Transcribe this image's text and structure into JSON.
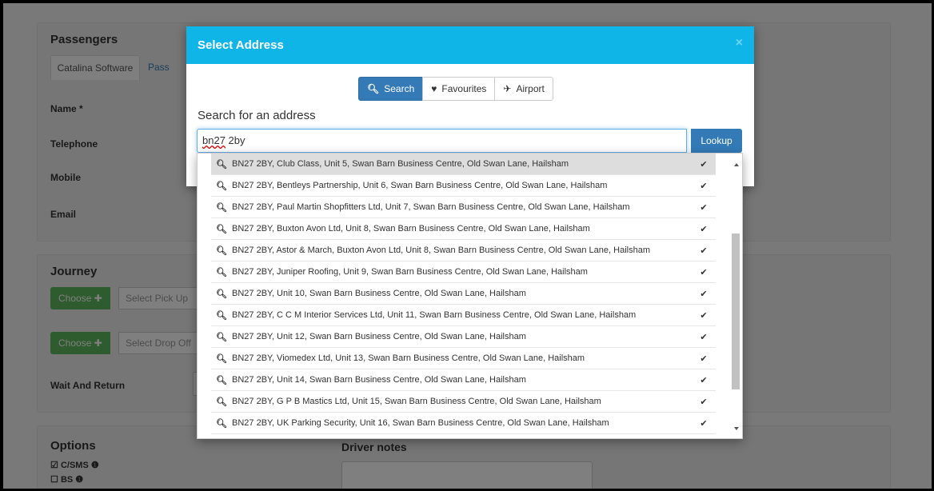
{
  "background": {
    "passengers": {
      "title": "Passengers",
      "tabs": [
        "Catalina Software",
        "Pass"
      ],
      "fields": [
        "Name *",
        "Telephone",
        "Mobile",
        "Email"
      ]
    },
    "journey": {
      "title": "Journey",
      "choose_label": "Choose",
      "pickup_placeholder": "Select Pick Up",
      "dropoff_placeholder": "Select Drop Off",
      "wait_return": "Wait And Return"
    },
    "options": {
      "title": "Options",
      "items": [
        "C/SMS",
        "BS"
      ],
      "driver_notes": "Driver notes"
    }
  },
  "modal": {
    "title": "Select Address",
    "close": "×",
    "tabs": [
      {
        "label": "Search",
        "icon": "search-icon"
      },
      {
        "label": "Favourites",
        "icon": "heart-icon"
      },
      {
        "label": "Airport",
        "icon": "plane-icon"
      }
    ],
    "search_label": "Search for an address",
    "search_value_typo": "bn27",
    "search_value_rest": " 2by",
    "lookup_label": "Lookup"
  },
  "results": [
    "BN27 2BY, Club Class, Unit 5, Swan Barn Business Centre, Old Swan Lane, Hailsham",
    "BN27 2BY, Bentleys Partnership, Unit 6, Swan Barn Business Centre, Old Swan Lane, Hailsham",
    "BN27 2BY, Paul Martin Shopfitters Ltd, Unit 7, Swan Barn Business Centre, Old Swan Lane, Hailsham",
    "BN27 2BY, Buxton Avon Ltd, Unit 8, Swan Barn Business Centre, Old Swan Lane, Hailsham",
    "BN27 2BY, Astor & March, Buxton Avon Ltd, Unit 8, Swan Barn Business Centre, Old Swan Lane, Hailsham",
    "BN27 2BY, Juniper Roofing, Unit 9, Swan Barn Business Centre, Old Swan Lane, Hailsham",
    "BN27 2BY, Unit 10, Swan Barn Business Centre, Old Swan Lane, Hailsham",
    "BN27 2BY, C C M Interior Services Ltd, Unit 11, Swan Barn Business Centre, Old Swan Lane, Hailsham",
    "BN27 2BY, Unit 12, Swan Barn Business Centre, Old Swan Lane, Hailsham",
    "BN27 2BY, Viomedex Ltd, Unit 13, Swan Barn Business Centre, Old Swan Lane, Hailsham",
    "BN27 2BY, Unit 14, Swan Barn Business Centre, Old Swan Lane, Hailsham",
    "BN27 2BY, G P B Mastics Ltd, Unit 15, Swan Barn Business Centre, Old Swan Lane, Hailsham",
    "BN27 2BY, UK Parking Security, Unit 16, Swan Barn Business Centre, Old Swan Lane, Hailsham"
  ],
  "colors": {
    "modal_header": "#10b5e8",
    "primary": "#337ab7",
    "success": "#5cb85c"
  }
}
